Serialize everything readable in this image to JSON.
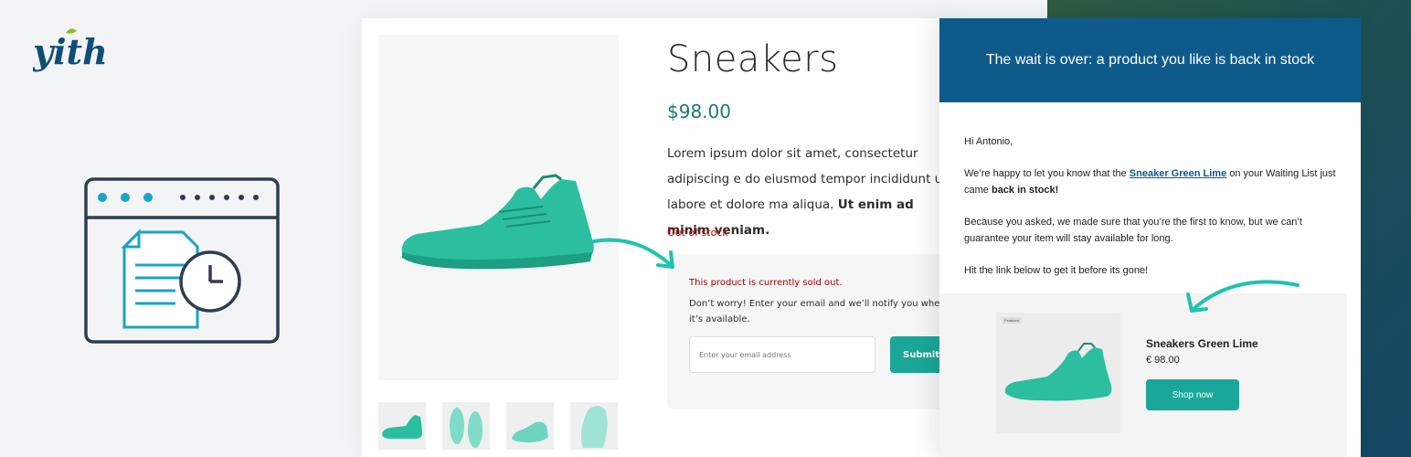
{
  "brand": {
    "logo_text": "yith",
    "accent": "#1aa79a",
    "logo_color": "#0e4f78"
  },
  "product": {
    "title": "Sneakers",
    "price": "$98.00",
    "description_text": "Lorem ipsum dolor sit amet, consectetur adipiscing e do eiusmod tempor incididunt ut labore et dolore ma aliqua.",
    "description_bold": "Ut enim ad minim veniam.",
    "stock_status": "Out of stock",
    "thumbnails": [
      "shoe-side",
      "shoe-top",
      "shoe-angle",
      "shoe-sole"
    ]
  },
  "notify_form": {
    "sold_out_message": "This product is currently sold out.",
    "instruction": "Don’t worry! Enter your email and we’ll notify you when it’s available.",
    "email_placeholder": "Enter your email address",
    "submit_label": "Submit"
  },
  "email": {
    "header": "The wait is over: a product you like is back in stock",
    "greeting": "Hi Antonio,",
    "intro_before": "We’re happy to let you know that the ",
    "product_link": "Sneaker Green Lime",
    "intro_middle": " on your Waiting List just came ",
    "intro_bold": "back in stock!",
    "paragraph2": "Because you asked, we made sure that you’re the first to know, but we can’t guarantee your item will stay available for long.",
    "paragraph3": "Hit the link below to get it before its gone!",
    "product_card": {
      "tag": "Featured",
      "name": "Sneakers Green Lime",
      "price": "€ 98.00",
      "button": "Shop now"
    }
  },
  "colors": {
    "header_blue": "#0e5a8a",
    "teal_button": "#1aa79a",
    "price_green": "#1c7a73",
    "out_of_stock_red": "#cc0000"
  }
}
